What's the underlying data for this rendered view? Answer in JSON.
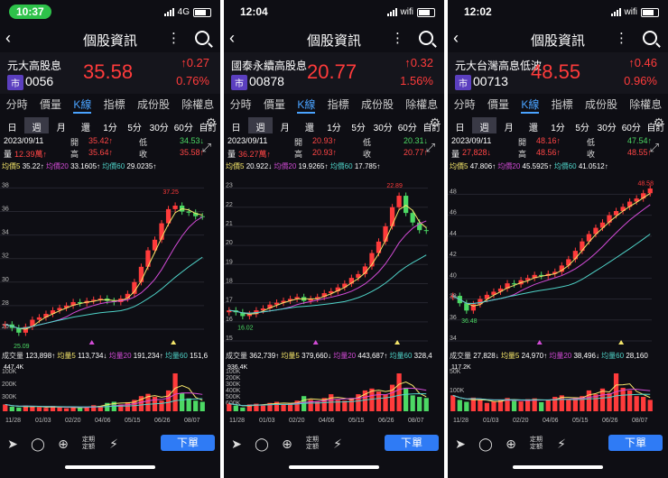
{
  "ui": {
    "navtitle": "個股資訊",
    "tabs": [
      "分時",
      "價量",
      "K線",
      "指標",
      "成份股",
      "除權息"
    ],
    "periods": [
      "日",
      "週",
      "月",
      "還",
      "1分",
      "5分",
      "30分",
      "60分",
      "自訂"
    ],
    "order": "下單",
    "dingqi": [
      "定期",
      "定額"
    ],
    "labels": {
      "open": "開",
      "high": "高",
      "low": "低",
      "vol": "量",
      "close": "收",
      "volhdr": "成交量",
      "ma5": "均價5",
      "ma20": "均價20",
      "ma60": "均價60",
      "mv5": "均量5",
      "mv20": "均量20",
      "mv60": "均量60"
    },
    "colors": {
      "up": "#ff3b3b",
      "down": "#4cd964",
      "ma5": "#f5e66a",
      "ma20": "#d24bd6",
      "ma60": "#4fd3c8",
      "active": "#4aa3ff"
    },
    "icons": [
      "share-icon",
      "bell-icon",
      "add-icon",
      "flash-icon",
      "gear-icon",
      "search-icon",
      "back-icon",
      "more-icon",
      "expand-icon"
    ]
  },
  "panels": [
    {
      "time": "10:37",
      "net": "4G",
      "name": "元大高股息",
      "market": "市",
      "code": "0056",
      "price": "35.58",
      "chg": "↑0.27",
      "pct": "0.76%",
      "date": "2023/09/11",
      "open": "35.42↑",
      "high": "34.53↓",
      "vol": "12.39萬↑",
      "close2": "35.64↑",
      "close": "35.58↑",
      "ma5": "35.22↑",
      "ma20": "33.1605↑",
      "ma60": "29.0235↑",
      "yticks": [
        "38",
        "36",
        "34",
        "32",
        "30",
        "28",
        "26"
      ],
      "peak": "37.25",
      "low": "25.09",
      "volinfo": "123,898↑",
      "mv5": "113,734↓",
      "mv20": "191,234↑",
      "mv60": "151,6",
      "maxvol": "447.4K",
      "vticks": [
        "300K",
        "200K",
        "100K"
      ],
      "dates": [
        "11/28",
        "01/03",
        "02/20",
        "04/06",
        "05/15",
        "06/26",
        "08/07"
      ],
      "closes": [
        26.4,
        26.1,
        25.7,
        26.2,
        26.8,
        27.0,
        27.3,
        27.6,
        27.8,
        28.0,
        28.3,
        28.2,
        28.4,
        28.5,
        28.6,
        28.4,
        28.3,
        28.6,
        29.0,
        30.0,
        31.3,
        32.7,
        33.6,
        35.0,
        36.2,
        36.5,
        36.0,
        35.9,
        35.6,
        35.58
      ],
      "vols": [
        0.18,
        0.12,
        0.1,
        0.15,
        0.12,
        0.11,
        0.09,
        0.14,
        0.1,
        0.08,
        0.12,
        0.09,
        0.1,
        0.16,
        0.14,
        0.22,
        0.25,
        0.18,
        0.24,
        0.3,
        0.4,
        0.46,
        0.38,
        0.28,
        0.55,
        1.0,
        0.48,
        0.34,
        0.28,
        0.25
      ],
      "ylim": [
        25,
        38.8
      ]
    },
    {
      "time": "12:04",
      "net": "wifi",
      "name": "國泰永續高股息",
      "market": "市",
      "code": "00878",
      "price": "20.77",
      "chg": "↑0.32",
      "pct": "1.56%",
      "date": "2023/09/11",
      "open": "20.93↑",
      "high": "20.31↓",
      "vol": "36.27萬↑",
      "close2": "20.93↑",
      "close": "20.77↑",
      "ma5": "20.922↓",
      "ma20": "19.9265↑",
      "ma60": "17.785↑",
      "yticks": [
        "23",
        "22",
        "21",
        "20",
        "19",
        "18",
        "17",
        "16",
        "15"
      ],
      "peak": "22.89",
      "low": "16.02",
      "volinfo": "362,739↑",
      "mv5": "379,660↓",
      "mv20": "443,687↑",
      "mv60": "328,4",
      "maxvol": "936.4K",
      "vticks": [
        "600K",
        "500K",
        "400K",
        "300K",
        "200K",
        "100K"
      ],
      "dates": [
        "11/28",
        "01/03",
        "02/20",
        "04/06",
        "05/15",
        "06/26",
        "08/07"
      ],
      "closes": [
        16.6,
        16.5,
        16.3,
        16.4,
        16.6,
        16.7,
        16.9,
        17.0,
        17.1,
        17.2,
        17.3,
        17.1,
        17.2,
        17.3,
        17.5,
        17.6,
        17.8,
        18.0,
        18.3,
        18.5,
        18.9,
        19.6,
        20.2,
        21.0,
        22.0,
        22.6,
        21.7,
        21.2,
        20.8,
        20.77
      ],
      "vols": [
        0.2,
        0.15,
        0.1,
        0.18,
        0.2,
        0.15,
        0.22,
        0.25,
        0.18,
        0.2,
        0.28,
        0.4,
        0.3,
        0.25,
        0.35,
        0.45,
        0.3,
        0.28,
        0.35,
        0.45,
        0.55,
        0.6,
        0.52,
        0.44,
        0.7,
        1.0,
        0.62,
        0.42,
        0.38,
        0.35
      ],
      "ylim": [
        15,
        23.5
      ]
    },
    {
      "time": "12:02",
      "net": "wifi",
      "name": "元大台灣高息低波",
      "market": "市",
      "code": "00713",
      "price": "48.55",
      "chg": "↑0.46",
      "pct": "0.96%",
      "date": "2023/09/11",
      "open": "48.16↑",
      "high": "47.54↑",
      "vol": "27,828↓",
      "close2": "48.56↑",
      "close": "48.55↑",
      "ma5": "47.806↑",
      "ma20": "45.5925↑",
      "ma60": "41.0512↑",
      "yticks": [
        "48",
        "46",
        "44",
        "42",
        "40",
        "38",
        "36",
        "34"
      ],
      "peak": "48.58",
      "low": "36.48",
      "volinfo": "27,828↓",
      "mv5": "24,970↑",
      "mv20": "38,496↓",
      "mv60": "28,160",
      "maxvol": "117.2K",
      "vticks": [
        "100K",
        "50K"
      ],
      "dates": [
        "11/28",
        "01/03",
        "02/20",
        "04/06",
        "05/15",
        "06/26",
        "08/07"
      ],
      "closes": [
        38.3,
        37.6,
        36.9,
        37.5,
        38.0,
        38.4,
        38.7,
        39.0,
        39.5,
        39.4,
        39.8,
        40.0,
        40.3,
        40.2,
        40.4,
        40.6,
        41.2,
        41.8,
        42.6,
        43.5,
        44.2,
        44.8,
        45.3,
        46.0,
        46.4,
        46.8,
        47.3,
        47.6,
        48.1,
        48.55
      ],
      "vols": [
        0.42,
        0.3,
        0.25,
        0.36,
        0.3,
        0.22,
        0.26,
        0.3,
        0.35,
        0.28,
        0.26,
        0.32,
        0.34,
        0.24,
        0.3,
        0.38,
        0.42,
        0.3,
        0.35,
        0.4,
        0.55,
        0.45,
        0.6,
        0.48,
        1.0,
        0.62,
        0.55,
        0.4,
        0.38,
        0.3
      ],
      "ylim": [
        34,
        49.5
      ]
    }
  ]
}
